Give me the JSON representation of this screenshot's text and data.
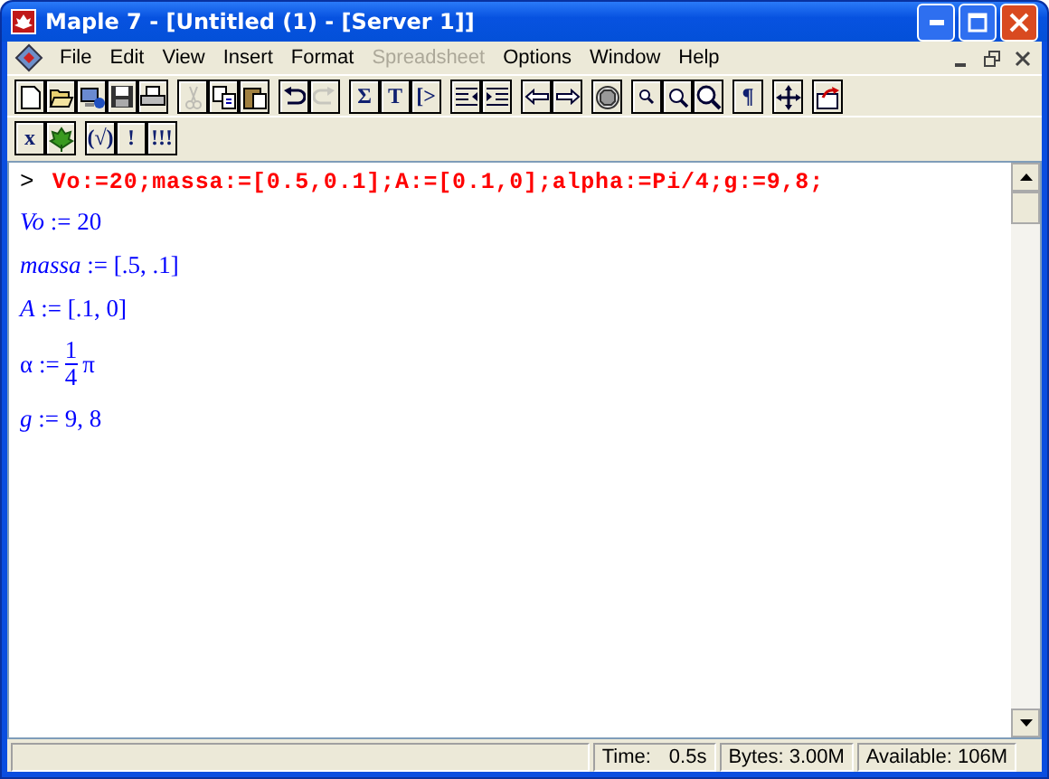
{
  "window": {
    "title": "Maple 7  - [Untitled (1) - [Server 1]]"
  },
  "menu": [
    {
      "label": "File",
      "disabled": false
    },
    {
      "label": "Edit",
      "disabled": false
    },
    {
      "label": "View",
      "disabled": false
    },
    {
      "label": "Insert",
      "disabled": false
    },
    {
      "label": "Format",
      "disabled": false
    },
    {
      "label": "Spreadsheet",
      "disabled": true
    },
    {
      "label": "Options",
      "disabled": false
    },
    {
      "label": "Window",
      "disabled": false
    },
    {
      "label": "Help",
      "disabled": false
    }
  ],
  "toolbars": [
    [
      [
        {
          "kind": "new",
          "disabled": false
        },
        {
          "kind": "open",
          "disabled": false
        },
        {
          "kind": "server",
          "disabled": false
        },
        {
          "kind": "save",
          "disabled": false
        },
        {
          "kind": "print",
          "disabled": false
        }
      ],
      [
        {
          "kind": "cut",
          "disabled": true
        },
        {
          "kind": "copy",
          "disabled": false
        },
        {
          "kind": "paste",
          "disabled": false
        }
      ],
      [
        {
          "kind": "undo",
          "disabled": false
        },
        {
          "kind": "redo",
          "disabled": true
        }
      ],
      [
        {
          "kind": "glyph",
          "text": "Σ",
          "disabled": false
        },
        {
          "kind": "glyph",
          "text": "T",
          "disabled": false
        },
        {
          "kind": "glyph",
          "text": "[>",
          "disabled": false
        }
      ],
      [
        {
          "kind": "outdent",
          "disabled": false
        },
        {
          "kind": "indent",
          "disabled": false
        }
      ],
      [
        {
          "kind": "back",
          "disabled": false
        },
        {
          "kind": "forward",
          "disabled": false
        }
      ],
      [
        {
          "kind": "stop",
          "disabled": false
        }
      ],
      [
        {
          "kind": "zoom1",
          "disabled": false
        },
        {
          "kind": "zoom2",
          "disabled": false
        },
        {
          "kind": "zoom3",
          "disabled": false
        }
      ],
      [
        {
          "kind": "glyph",
          "text": "¶",
          "disabled": false
        }
      ],
      [
        {
          "kind": "move",
          "disabled": false
        }
      ],
      [
        {
          "kind": "restart",
          "disabled": false
        }
      ]
    ],
    [
      [
        {
          "kind": "glyph",
          "text": "x",
          "disabled": false
        },
        {
          "kind": "leaf",
          "disabled": false
        }
      ],
      [
        {
          "kind": "glyph",
          "text": "(√)",
          "disabled": false
        },
        {
          "kind": "glyph",
          "text": "!",
          "disabled": false
        },
        {
          "kind": "glyph",
          "text": "!!!",
          "disabled": false
        }
      ]
    ]
  ],
  "worksheet": {
    "prompt": ">",
    "input": "Vo:=20;massa:=[0.5,0.1];A:=[0.1,0];alpha:=Pi/4;g:=9,8;",
    "outputs": [
      {
        "kind": "plain",
        "text": "*Vo* := 20"
      },
      {
        "kind": "plain",
        "text": "*massa* := [.5, .1]"
      },
      {
        "kind": "plain",
        "text": "*A* := [.1, 0]"
      },
      {
        "kind": "fraction",
        "lhs": "α :=",
        "numerator": "1",
        "denominator": "4",
        "rest": "π"
      },
      {
        "kind": "plain",
        "text": "*g* := 9, 8"
      }
    ]
  },
  "status_bar": {
    "time_label": "Time:",
    "time": "0.5s",
    "bytes": "Bytes: 3.00M",
    "available": "Available: 106M"
  }
}
